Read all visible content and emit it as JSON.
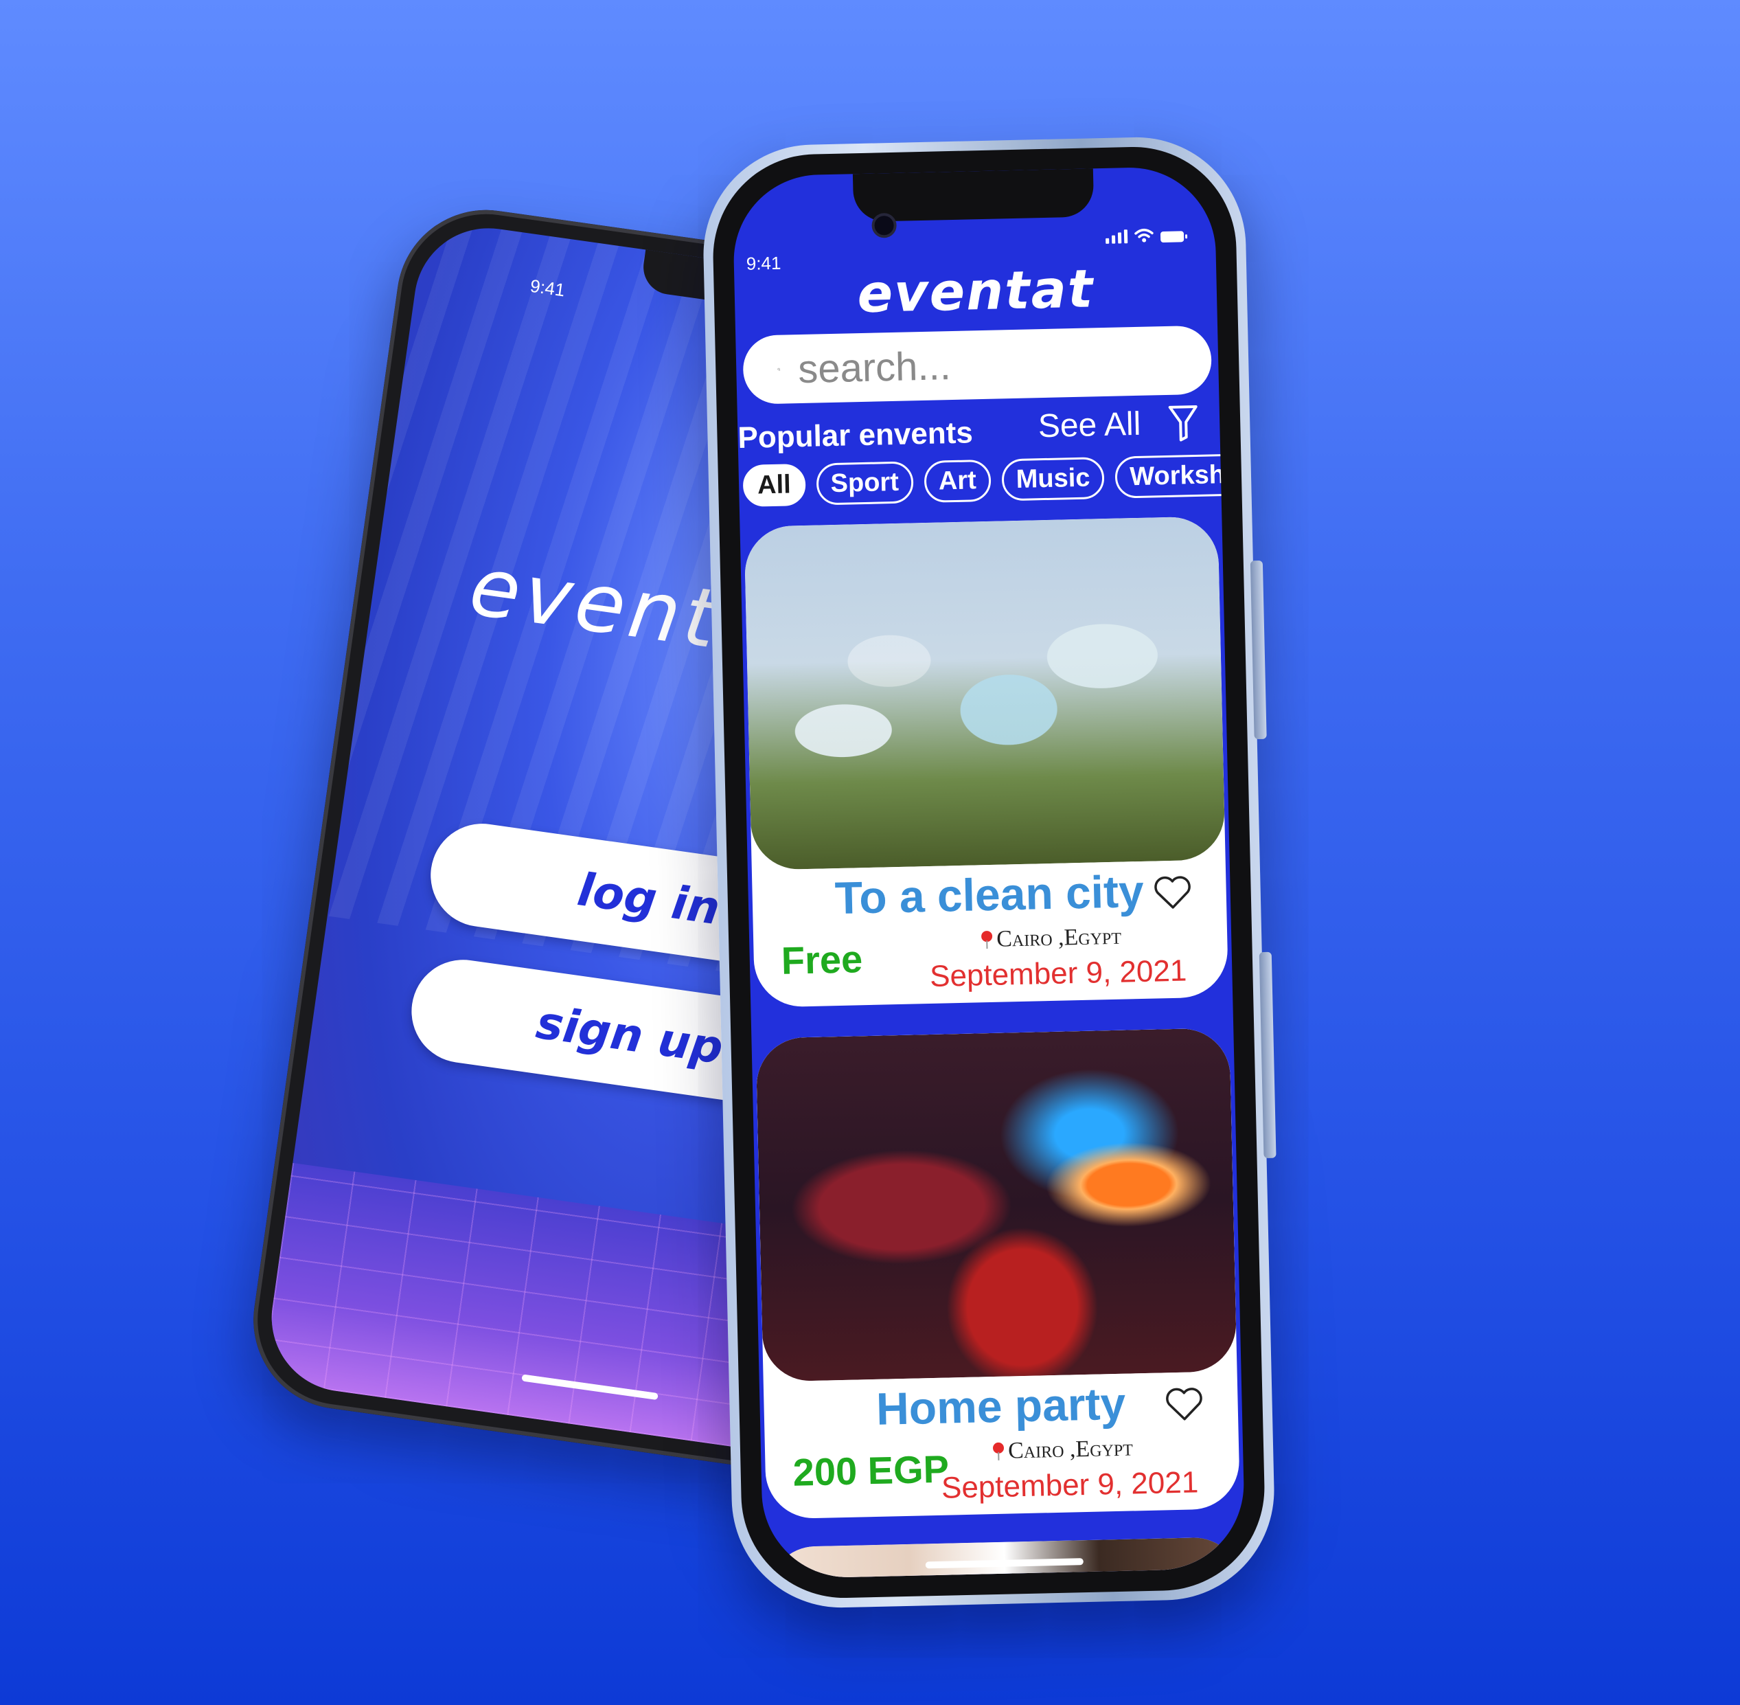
{
  "welcome_screen": {
    "time": "9:41",
    "logo": "eventat",
    "login_label": "log in",
    "signup_label": "sign up"
  },
  "events_screen": {
    "time": "9:41",
    "app_title": "eventat",
    "search_placeholder": "search...",
    "section_title": "Popular envents",
    "see_all_label": "See All",
    "categories": [
      "All",
      "Sport",
      "Art",
      "Music",
      "Workshop"
    ],
    "selected_category": "All",
    "events": [
      {
        "title": "To a clean city",
        "price": "Free",
        "location": "Cairo ,Egypt",
        "date": "September 9, 2021",
        "price_color": "#1faa1f"
      },
      {
        "title": "Home party",
        "price": "200 EGP",
        "location": "Cairo ,Egypt",
        "date": "September 9, 2021",
        "price_color": "#1faa1f"
      }
    ]
  },
  "colors": {
    "brand_blue": "#2230dc",
    "title_blue": "#3a8fd8",
    "price_green": "#1faa1f",
    "date_red": "#e23030",
    "background_top": "#5f8bff",
    "background_bottom": "#0d3ad6"
  },
  "icons": [
    "search-icon",
    "filter-icon",
    "heart-icon",
    "location-pin-icon",
    "signal-icon",
    "wifi-icon",
    "battery-icon"
  ]
}
